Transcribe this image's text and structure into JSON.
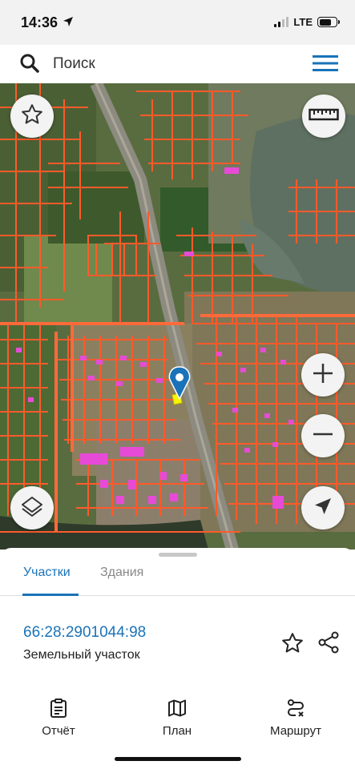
{
  "status_bar": {
    "time": "14:36",
    "network": "LTE"
  },
  "search": {
    "placeholder": "Поиск"
  },
  "map": {
    "icons": [
      "star-icon",
      "ruler-icon",
      "zoom-in-icon",
      "zoom-out-icon",
      "layers-icon",
      "navigation-arrow-icon",
      "location-pin-icon"
    ]
  },
  "sheet": {
    "tabs": [
      {
        "label": "Участки",
        "active": true
      },
      {
        "label": "Здания",
        "active": false
      }
    ],
    "parcel": {
      "cadastral_number": "66:28:2901044:98",
      "type": "Земельный участок"
    }
  },
  "bottom_nav": [
    {
      "label": "Отчёт",
      "icon": "report-icon"
    },
    {
      "label": "План",
      "icon": "map-plan-icon"
    },
    {
      "label": "Маршрут",
      "icon": "route-icon"
    }
  ],
  "colors": {
    "accent": "#1a73b8",
    "parcel_outline": "#ff5a2a",
    "building": "#e84ad8",
    "selected_parcel": "#f5f500"
  }
}
